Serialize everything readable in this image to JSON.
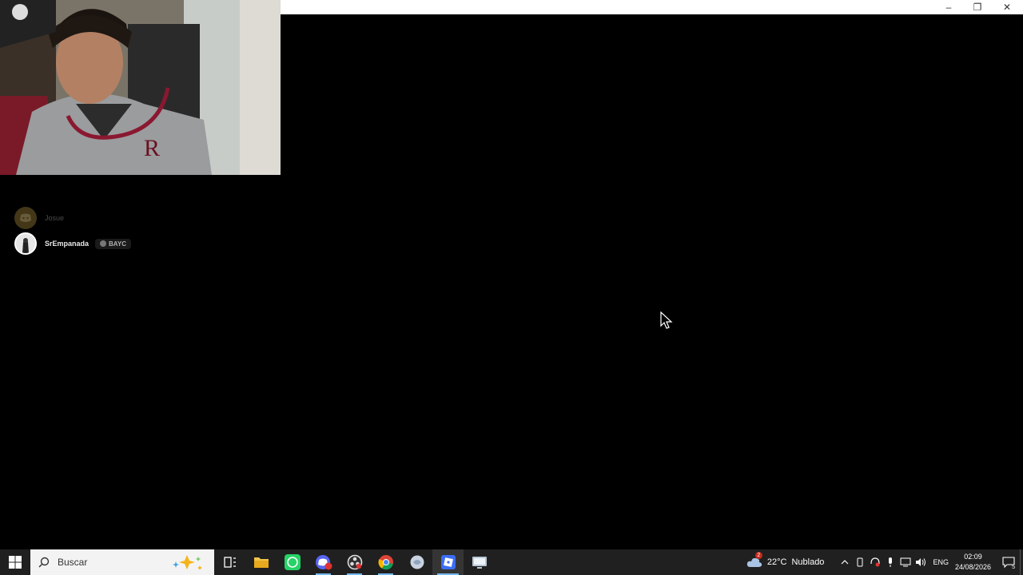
{
  "window": {
    "controls": {
      "minimize": "–",
      "restore": "❐",
      "close": "✕"
    }
  },
  "voice": {
    "users": [
      {
        "name": "Josue",
        "active": false
      },
      {
        "name": "SrEmpanada",
        "active": true,
        "badge": "BAYC"
      }
    ]
  },
  "taskbar": {
    "search_placeholder": "Buscar",
    "apps": [
      "task-view",
      "file-explorer",
      "whatsapp",
      "discord-ptb",
      "obs-studio",
      "chrome",
      "browser-app",
      "roblox",
      "remote-desktop"
    ],
    "weather": {
      "temp": "22°C",
      "condition": "Nublado",
      "badge": "2"
    },
    "language": "ENG",
    "time": "02:09",
    "date": "24/08/2026",
    "notifications": "5"
  }
}
